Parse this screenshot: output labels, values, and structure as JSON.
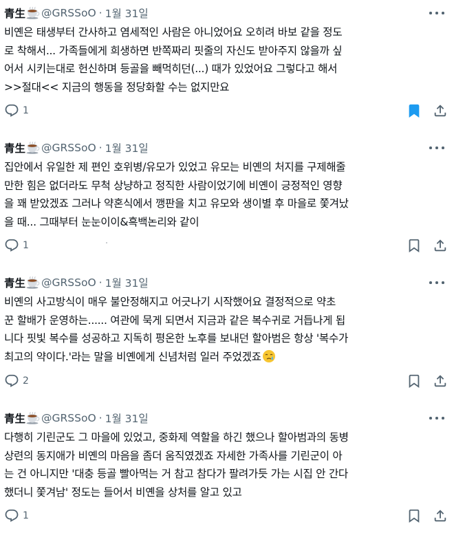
{
  "colors": {
    "text_primary": "#0f1419",
    "text_secondary": "#536471",
    "bookmark_active": "#1d9bf0",
    "background": "#ffffff"
  },
  "tweets": [
    {
      "author": {
        "name": "青生",
        "emoji_icon": "coffee-icon",
        "handle": "@GRSSoO"
      },
      "separator": "·",
      "date": "1월 31일",
      "text_lines": [
        "비옌은 태생부터 간사하고 염세적인 사람은 아니었어요 오히려 바보 같을 정도",
        "로 착해서... 가족들에게 희생하면 반쪽짜리 핏줄의 자신도 받아주지 않을까 싶",
        "어서 시키는대로 헌신하며 등골을 빼먹히던(...) 때가 있었어요 그렇다고 해서",
        ">>절대<< 지금의 행동을 정당화할 수는 없지만요"
      ],
      "reply_count": "1",
      "bookmarked": true
    },
    {
      "author": {
        "name": "青生",
        "emoji_icon": "coffee-icon",
        "handle": "@GRSSoO"
      },
      "separator": "·",
      "date": "1월 31일",
      "text_lines": [
        "집안에서 유일한 제 편인 호위병/유모가 있었고 유모는 비옌의 처지를 구제해줄",
        "만한 힘은 없더라도 무척 상냥하고 정직한 사람이었기에 비옌이 긍정적인 영향",
        "을 꽤 받았겠죠 그러나 약혼식에서 깽판을 치고 유모와 생이별 후 마을로 쫓겨났",
        "을 때... 그때부터 눈눈이이&흑백논리와 같이"
      ],
      "reply_count": "1",
      "bookmarked": false
    },
    {
      "author": {
        "name": "青生",
        "emoji_icon": "coffee-icon",
        "handle": "@GRSSoO"
      },
      "separator": "·",
      "date": "1월 31일",
      "text_lines": [
        "비옌의 사고방식이 매우 불안정해지고 어긋나기 시작했어요 결정적으로 약초",
        "꾼 할배가 운영하는...... 여관에 묵게 되면서 지금과 같은 복수귀로 거듭나게 됩",
        "니다 핏빛 복수를 성공하고 지독히 평온한 노후를 보내던 할아범은 항상 '복수가",
        "최고의 약이다.'라는 말을 비옌에게 신념처럼 일러 주었겠죠"
      ],
      "trailing_emoji": "crying-face-icon",
      "reply_count": "2",
      "bookmarked": false
    },
    {
      "author": {
        "name": "青生",
        "emoji_icon": "coffee-icon",
        "handle": "@GRSSoO"
      },
      "separator": "·",
      "date": "1월 31일",
      "text_lines": [
        "다행히 기린군도 그 마을에 있었고, 중화제 역할을 하긴 했으나 할아범과의 동병",
        "상련의 동지애가 비옌의 마음을 좀더 움직였겠죠 자세한 가족사를 기린군이 아",
        "는 건 아니지만 '대충 등골 빨아먹는 거 참고 참다가 팔려가듯 가는 시집 안 간다",
        "했더니 쫓겨남' 정도는 들어서 비옌을 상처를 알고 있고"
      ],
      "reply_count": "1",
      "bookmarked": false
    }
  ]
}
